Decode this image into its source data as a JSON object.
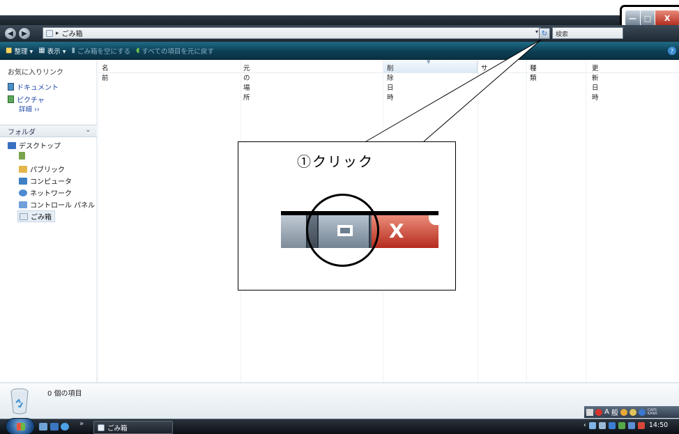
{
  "window": {
    "minimize_glyph": "—",
    "maximize_glyph": "□",
    "close_glyph": "X"
  },
  "address_bar": {
    "back_glyph": "◀",
    "forward_glyph": "▶",
    "separator": "▸",
    "path": "ごみ箱",
    "dropdown_glyph": "▾",
    "refresh_glyph": "↻",
    "search_placeholder": "検索"
  },
  "toolbar": {
    "organize": "整理 ▾",
    "views": "表示 ▾",
    "empty_bin": "ごみ箱を空にする",
    "restore_all": "すべての項目を元に戻す",
    "help_glyph": "?"
  },
  "nav": {
    "favorites_header": "お気に入りリンク",
    "favorites": [
      {
        "label": "ドキュメント"
      },
      {
        "label": "ピクチャ"
      }
    ],
    "more_label": "詳細 ›› ",
    "folders_header": "フォルダ",
    "folders_chevron": "⌄",
    "tree": [
      {
        "label": "デスクトップ"
      },
      {
        "label": ""
      },
      {
        "label": "パブリック"
      },
      {
        "label": "コンピュータ"
      },
      {
        "label": "ネットワーク"
      },
      {
        "label": "コントロール パネル"
      },
      {
        "label": "ごみ箱"
      }
    ]
  },
  "columns": [
    {
      "label": "名前"
    },
    {
      "label": "元の場所"
    },
    {
      "label": "削除日時"
    },
    {
      "label": "サイ"
    },
    {
      "label": "種類"
    },
    {
      "label": "更新日時"
    }
  ],
  "details": {
    "item_count": "0 個の項目"
  },
  "ime": {
    "mode": "A",
    "kanji": "般",
    "caps": "CAPS",
    "kana": "KANA"
  },
  "taskbar": {
    "quicklaunch_more": "»",
    "task_label": "ごみ箱",
    "tray_arrow": "‹",
    "clock": "14:50"
  },
  "callout": {
    "instruction": "①クリック",
    "zoom_close_glyph": "X"
  }
}
